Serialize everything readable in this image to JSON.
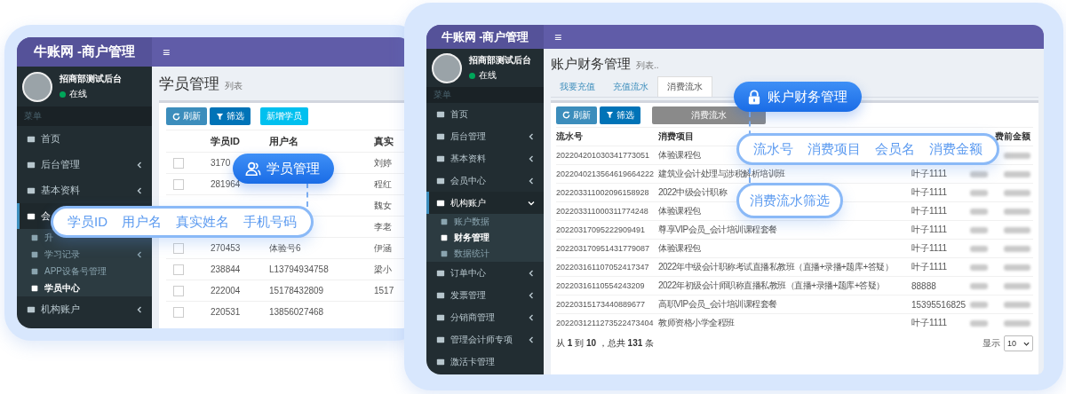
{
  "windows": [
    {
      "kind": "students",
      "brand": "牛账网 -商户管理",
      "menu_glyph": "≡",
      "user": {
        "name": "招商部测试后台",
        "status": "在线",
        "online": true
      },
      "menu_label": "菜单",
      "nav": [
        {
          "label": "首页",
          "selected": false
        },
        {
          "label": "后台管理",
          "selected": false,
          "expanded": false
        },
        {
          "label": "基本资料",
          "selected": false,
          "expanded": false
        },
        {
          "label": "会",
          "selected": true,
          "expanded": true,
          "children": [
            {
              "label": "升",
              "selected": false
            },
            {
              "label": "学习记录",
              "selected": false,
              "expanded": false
            },
            {
              "label": "APP设备号管理",
              "selected": false
            },
            {
              "label": "学员中心",
              "selected": true
            }
          ]
        },
        {
          "label": "机构账户",
          "selected": false,
          "expanded": false
        }
      ],
      "page_title": "学员管理",
      "page_subtitle": "列表",
      "buttons": [
        {
          "label": "刷新",
          "kind": "refresh"
        },
        {
          "label": "筛选",
          "kind": "filter"
        },
        {
          "label": "新增学员",
          "kind": "add"
        }
      ],
      "columns": [
        "学员ID",
        "用户名",
        "真实"
      ],
      "rows": [
        {
          "checked": false,
          "id": "3170",
          "real_name": "刘婷"
        },
        {
          "checked": false,
          "id": "281964",
          "real_name": "程红"
        },
        {
          "real_name": "魏女"
        },
        {
          "real_name": "李老"
        },
        {
          "checked": false,
          "id": "270453",
          "username": "体验号6",
          "real_name": "伊涵"
        },
        {
          "checked": false,
          "id": "238844",
          "username": "L13794934758",
          "real_name": "梁小"
        },
        {
          "checked": false,
          "id": "222004",
          "username": "15178432809",
          "real_name": "1517"
        },
        {
          "checked": false,
          "id": "220531",
          "username": "13856027468"
        }
      ]
    },
    {
      "kind": "finance",
      "brand": "牛账网 -商户管理",
      "menu_glyph": "≡",
      "user": {
        "name": "招商部测试后台",
        "status": "在线",
        "online": true
      },
      "menu_label": "菜单",
      "nav": [
        {
          "label": "首页",
          "selected": false
        },
        {
          "label": "后台管理",
          "selected": false,
          "expanded": false
        },
        {
          "label": "基本资料",
          "selected": false,
          "expanded": false
        },
        {
          "label": "会员中心",
          "selected": false,
          "expanded": false
        },
        {
          "label": "机构账户",
          "selected": true,
          "expanded": true,
          "children": [
            {
              "label": "账户数据",
              "selected": false
            },
            {
              "label": "财务管理",
              "selected": true
            },
            {
              "label": "数据统计",
              "selected": false
            }
          ]
        },
        {
          "label": "订单中心",
          "selected": false,
          "expanded": false
        },
        {
          "label": "发票管理",
          "selected": false,
          "expanded": false
        },
        {
          "label": "分销商管理",
          "selected": false,
          "expanded": false
        },
        {
          "label": "管理会计师专项",
          "selected": false,
          "expanded": false
        },
        {
          "label": "激活卡管理",
          "selected": false
        }
      ],
      "page_title": "账户财务管理",
      "page_subtitle": "列表..",
      "tabs": [
        {
          "label": "我要充值",
          "selected": false
        },
        {
          "label": "充值流水",
          "selected": false
        },
        {
          "label": "消费流水",
          "selected": true
        }
      ],
      "buttons": [
        {
          "label": "刷新",
          "kind": "refresh"
        },
        {
          "label": "筛选",
          "kind": "filter"
        },
        {
          "label": "消费流水",
          "kind": "plain"
        }
      ],
      "columns": {
        "serial_no": "流水号",
        "item": "消费项目",
        "column_5": "费前金额"
      },
      "rows": [
        {
          "serial_no": "202204201030341773051",
          "item": "体验课程包"
        },
        {
          "serial_no": "2022040213564619664222",
          "item": "建筑业会计处理与涉税解析培训班",
          "member": "叶子1111"
        },
        {
          "serial_no": "202203311002096158928",
          "item": "2022中级会计职称",
          "member": "叶子1111"
        },
        {
          "serial_no": "202203311000311774248",
          "item": "体验课程包",
          "member": "叶子1111"
        },
        {
          "serial_no": "20220317095222909491",
          "item": "尊享VIP会员_会计培训课程套餐",
          "member": "叶子1111"
        },
        {
          "serial_no": "202203170951431779087",
          "item": "体验课程包",
          "member": "叶子1111"
        },
        {
          "serial_no": "202203161107052417347",
          "item": "2022年中级会计职称考试直播私教班（直播+录播+题库+答疑）",
          "member": "叶子1111"
        },
        {
          "serial_no": "20220316110554243209",
          "item": "2022年初级会计师职称直播私教班（直播+录播+题库+答疑）",
          "member": "88888"
        },
        {
          "serial_no": "20220315173440889677",
          "item": "高职VIP会员_会计培训课程套餐",
          "member": "15395516825"
        },
        {
          "serial_no": "2022031211273522473404",
          "item": "教师资格小学全程班",
          "member": "叶子1111"
        }
      ],
      "summary": "从 **1** 到 **10** ，总共 **131** 条",
      "page_size_label": "显示",
      "page_size": "10"
    }
  ],
  "callouts": [
    {
      "kind": "module",
      "label": "学员管理"
    },
    {
      "kind": "fields",
      "items": [
        "学员ID",
        "用户名",
        "真实姓名",
        "手机号码"
      ]
    },
    {
      "kind": "module",
      "label": "账户财务管理"
    },
    {
      "kind": "fields",
      "items": [
        "流水号",
        "消费项目",
        "会员名",
        "消费金额"
      ]
    },
    {
      "kind": "feature",
      "label": "消费流水筛选"
    }
  ]
}
